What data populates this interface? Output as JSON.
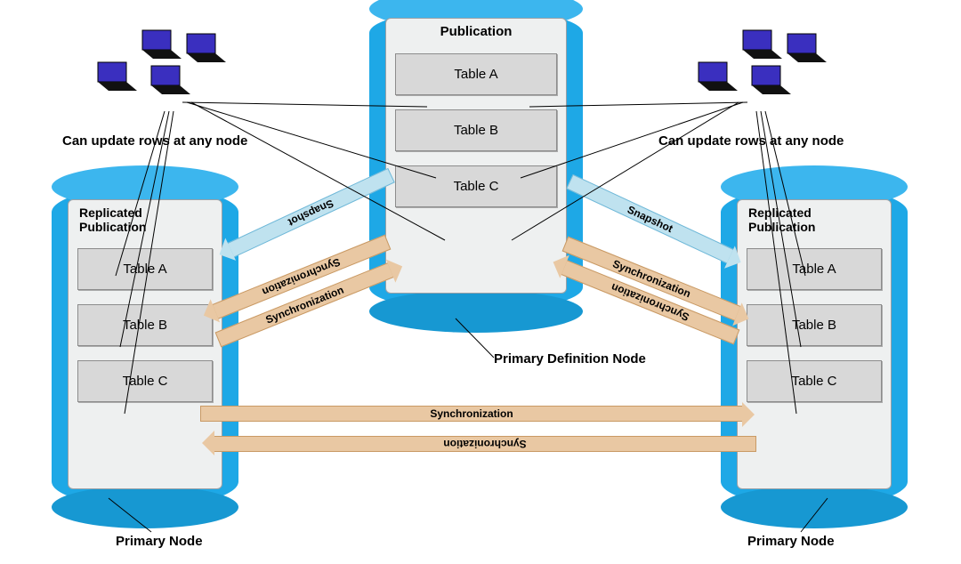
{
  "nodes": {
    "center": {
      "title": "Publication",
      "tables": [
        "Table A",
        "Table B",
        "Table C"
      ],
      "label": "Primary Definition Node"
    },
    "left": {
      "title": "Replicated Publication",
      "tables": [
        "Table A",
        "Table B",
        "Table C"
      ],
      "label": "Primary Node"
    },
    "right": {
      "title": "Replicated Publication",
      "tables": [
        "Table A",
        "Table B",
        "Table C"
      ],
      "label": "Primary Node"
    }
  },
  "notes": {
    "update_left": "Can update rows at any node",
    "update_right": "Can update rows at any node"
  },
  "arrows": {
    "snapshot": "Snapshot",
    "sync": "Synchronization"
  },
  "colors": {
    "db": "#1ea8e6",
    "arrow_sync": "#e9c8a3",
    "arrow_snap": "#bfe2ef"
  }
}
